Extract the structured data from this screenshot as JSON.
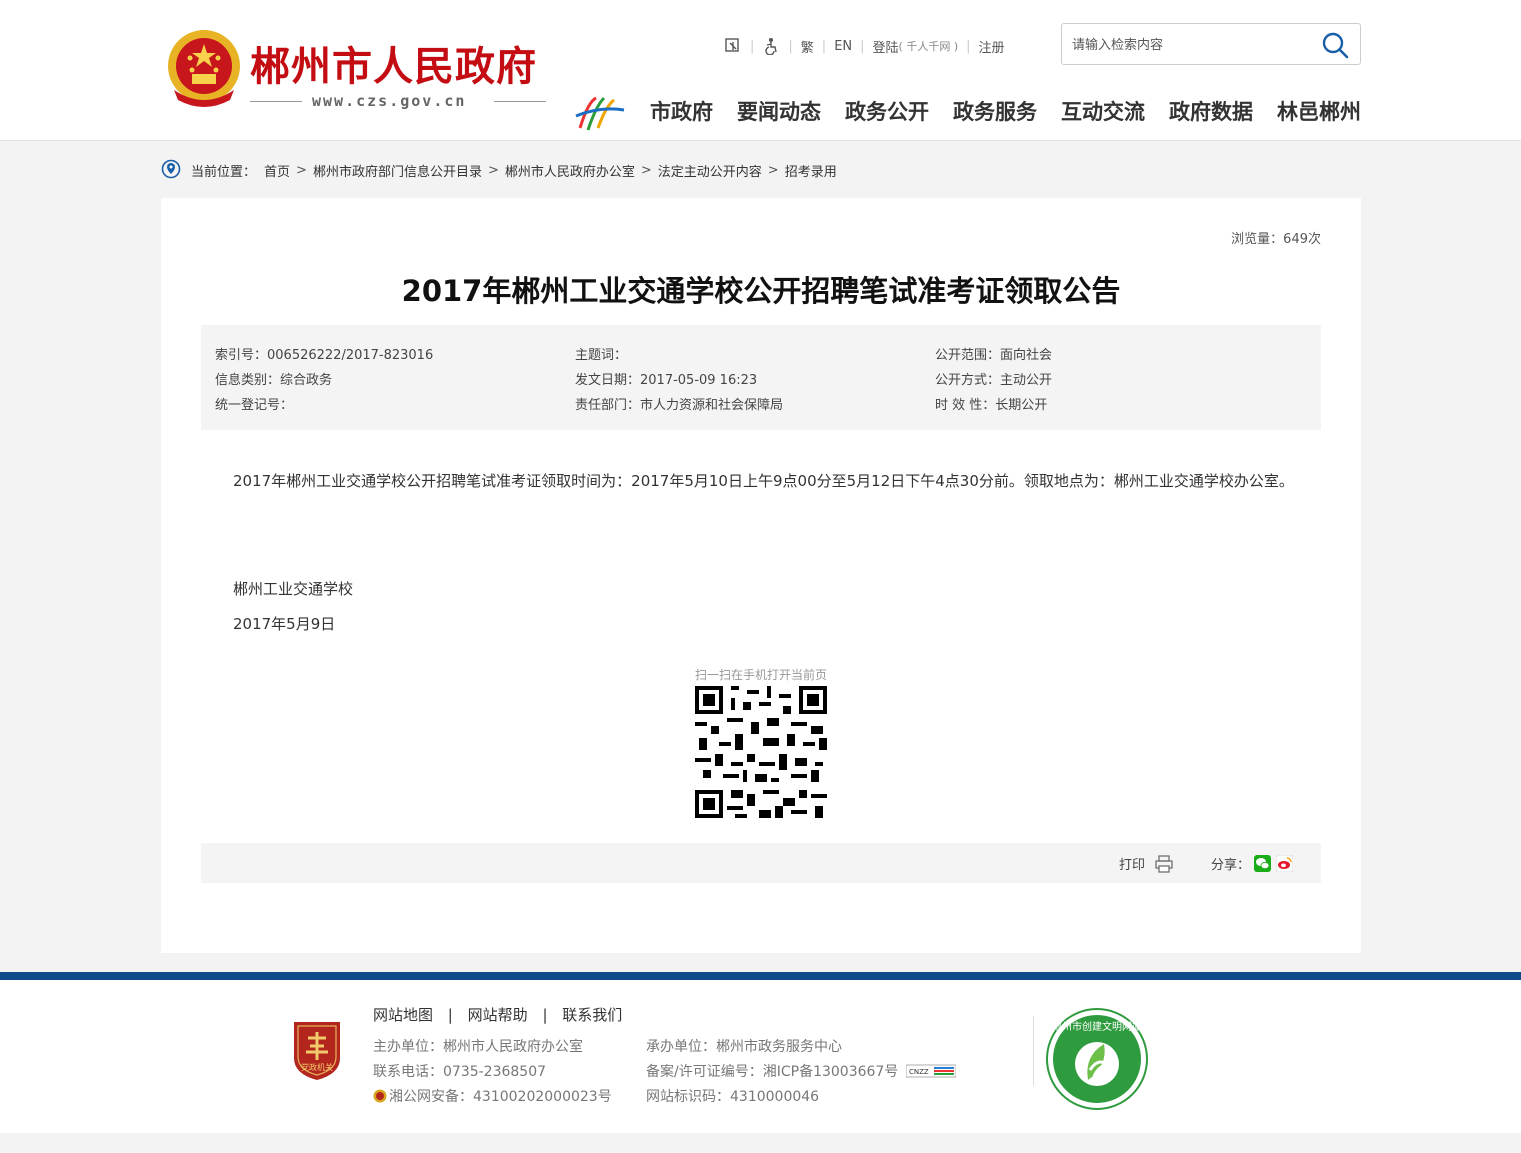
{
  "header": {
    "site_title": "郴州市人民政府",
    "site_url": "www.czs.gov.cn",
    "toplinks": {
      "traditional": "繁",
      "english": "EN",
      "login": "登陆",
      "login_note": "( 千人千网 )",
      "register": "注册"
    },
    "search": {
      "placeholder": "请输入检索内容"
    },
    "nav": [
      "市政府",
      "要闻动态",
      "政务公开",
      "政务服务",
      "互动交流",
      "政府数据",
      "林邑郴州"
    ]
  },
  "breadcrumb": {
    "label": "当前位置：",
    "items": [
      "首页",
      "郴州市政府部门信息公开目录",
      "郴州市人民政府办公室",
      "法定主动公开内容",
      "招考录用"
    ],
    "separator": ">"
  },
  "article": {
    "views": "浏览量：649次",
    "title": "2017年郴州工业交通学校公开招聘笔试准考证领取公告",
    "meta": {
      "index_no": "索引号：006526222/2017-823016",
      "subject": "主题词：",
      "scope": "公开范围：面向社会",
      "category": "信息类别：综合政务",
      "date": "发文日期：2017-05-09 16:23",
      "method": "公开方式：主动公开",
      "reg_no": "统一登记号：",
      "dept": "责任部门：市人力资源和社会保障局",
      "validity": "时 效 性：长期公开"
    },
    "body": "2017年郴州工业交通学校公开招聘笔试准考证领取时间为：2017年5月10日上午9点00分至5月12日下午4点30分前。领取地点为：郴州工业交通学校办公室。",
    "signature": "郴州工业交通学校",
    "sign_date": "2017年5月9日",
    "qr_caption": "扫一扫在手机打开当前页",
    "print_label": "打印",
    "share_label": "分享："
  },
  "footer": {
    "links": [
      "网站地图",
      "网站帮助",
      "联系我们"
    ],
    "sponsor": "主办单位：郴州市人民政府办公室",
    "phone": "联系电话：0735-2368507",
    "police": "湘公网安备：43100202000023号",
    "organizer": "承办单位：郴州市政务服务中心",
    "icp": "备案/许可证编号：湘ICP备13003667号",
    "site_id": "网站标识码：4310000046",
    "badge_text": "党政机关",
    "civil_text": "郴州市创建文明网站",
    "cnzz_text": "CNZZ"
  },
  "colors": {
    "brand_red": "#c40d12",
    "footer_blue": "#0f4a8a",
    "share_green": "#1aad19"
  }
}
